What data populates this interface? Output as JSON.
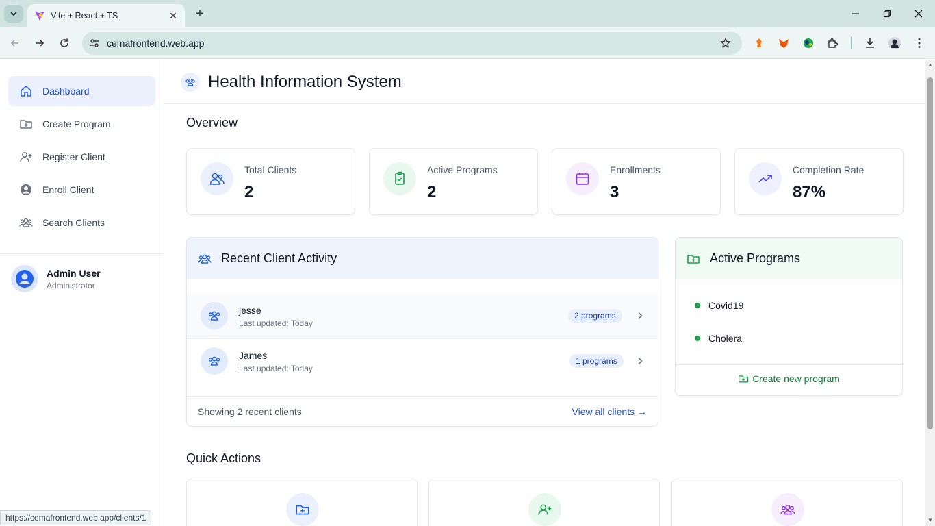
{
  "browser": {
    "tab_title": "Vite + React + TS",
    "url": "cemafrontend.web.app",
    "status_url": "https://cemafrontend.web.app/clients/1"
  },
  "sidebar": {
    "items": [
      {
        "label": "Dashboard",
        "icon": "home-icon",
        "active": true
      },
      {
        "label": "Create Program",
        "icon": "folder-plus-icon"
      },
      {
        "label": "Register Client",
        "icon": "user-plus-icon"
      },
      {
        "label": "Enroll Client",
        "icon": "user-circle-icon"
      },
      {
        "label": "Search Clients",
        "icon": "users-icon"
      }
    ],
    "user": {
      "name": "Admin User",
      "role": "Administrator"
    }
  },
  "header": {
    "title": "Health Information System"
  },
  "overview": {
    "title": "Overview",
    "stats": [
      {
        "label": "Total Clients",
        "value": "2",
        "icon": "users-icon",
        "color": "#2563eb"
      },
      {
        "label": "Active Programs",
        "value": "2",
        "icon": "clipboard-check-icon",
        "color": "#16a34a"
      },
      {
        "label": "Enrollments",
        "value": "3",
        "icon": "calendar-icon",
        "color": "#9333ea"
      },
      {
        "label": "Completion Rate",
        "value": "87%",
        "icon": "trending-up-icon",
        "color": "#4f46e5"
      }
    ]
  },
  "recent": {
    "title": "Recent Client Activity",
    "clients": [
      {
        "name": "jesse",
        "updated": "Last updated: Today",
        "programs": "2 programs"
      },
      {
        "name": "James",
        "updated": "Last updated: Today",
        "programs": "1 programs"
      }
    ],
    "footer_left": "Showing 2 recent clients",
    "footer_right": "View all clients →"
  },
  "programs": {
    "title": "Active Programs",
    "items": [
      "Covid19",
      "Cholera"
    ],
    "create_label": "Create new program"
  },
  "quick_actions": {
    "title": "Quick Actions"
  },
  "colors": {
    "accent": "#1d4ed8",
    "green": "#16a34a",
    "purple": "#9333ea"
  }
}
